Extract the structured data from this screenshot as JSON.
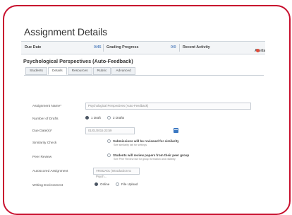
{
  "page": {
    "title": "Assignment Details",
    "assignment_title": "Psychological Perspectives (Auto-Feedback)"
  },
  "header": {
    "due_date_label": "Due Date",
    "due_date_count": "0/45",
    "grading_label": "Grading Progress",
    "grading_count": "0/0",
    "recent_label": "Recent Activity",
    "alerts_label": "Alerts"
  },
  "tabs": [
    "Students",
    "Details",
    "Resources",
    "Rubric",
    "Advanced"
  ],
  "form": {
    "name_label": "Assignment Name*",
    "name_value": "Psychological Perspectives (Auto-Feedback)",
    "drafts_label": "Number of Drafts",
    "drafts_options": [
      "1 Draft",
      "2 Drafts"
    ],
    "due_label": "Due Date(s)*",
    "due_value": "01/01/2015 23:59",
    "similarity_label": "Similarity Check",
    "similarity_text": "Submissions will be reviewed for similarity",
    "similarity_sub": "See similarity tab for settings",
    "peer_label": "Peer Review",
    "peer_text": "Students will review papers from their peer group",
    "peer_sub": "See Peer Review tab for group formation and visibility",
    "auto_label": "Autoscored Assignment",
    "auto_value": "VRSI2A01 (Introduction to Psych...",
    "writing_label": "Writing Environment",
    "writing_options": [
      "Online",
      "File Upload"
    ]
  },
  "colors": {
    "accent": "#c8102e",
    "link": "#3b78c2"
  }
}
